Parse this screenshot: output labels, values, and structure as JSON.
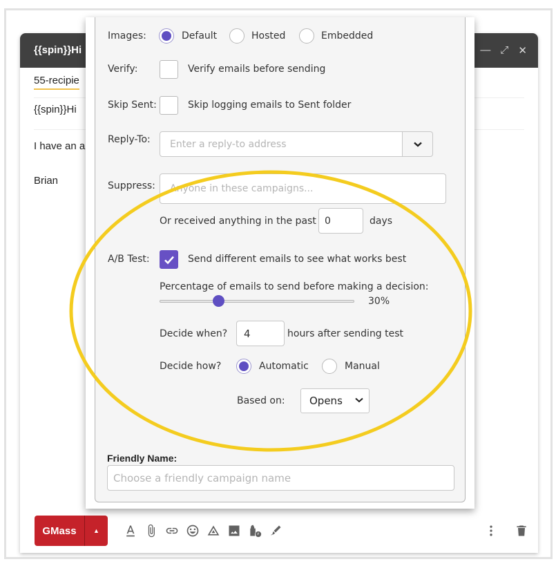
{
  "compose": {
    "title": "{{spin}}Hi",
    "to": "55-recipie",
    "subject": "{{spin}}Hi",
    "body_line1": "I have an a",
    "body_line2": "Brian",
    "window_controls": [
      "minimize-icon",
      "expand-icon",
      "close-icon"
    ]
  },
  "popup": {
    "images": {
      "label": "Images:",
      "options": [
        {
          "label": "Default",
          "selected": true
        },
        {
          "label": "Hosted",
          "selected": false
        },
        {
          "label": "Embedded",
          "selected": false
        }
      ]
    },
    "verify": {
      "label": "Verify:",
      "checked": false,
      "text": "Verify emails before sending"
    },
    "skip_sent": {
      "label": "Skip Sent:",
      "checked": false,
      "text": "Skip logging emails to Sent folder"
    },
    "reply_to": {
      "label": "Reply-To:",
      "value": "",
      "placeholder": "Enter a reply-to address"
    },
    "suppress": {
      "label": "Suppress:",
      "value": "",
      "placeholder": "Anyone in these campaigns...",
      "received_prefix": "Or received anything in the past",
      "days_value": "0",
      "days_suffix": "days"
    },
    "ab_test": {
      "label": "A/B Test:",
      "checked": true,
      "text": "Send different emails to see what works best",
      "percentage_label": "Percentage of emails to send before making a decision:",
      "percentage_value": 30,
      "percentage_text": "30%",
      "decide_when_label": "Decide when?",
      "decide_when_value": "4",
      "decide_when_suffix": "hours after sending test",
      "decide_how_label": "Decide how?",
      "decide_how_options": [
        {
          "label": "Automatic",
          "selected": true
        },
        {
          "label": "Manual",
          "selected": false
        }
      ],
      "based_on_label": "Based on:",
      "based_on_value": "Opens"
    },
    "friendly_name": {
      "label": "Friendly Name:",
      "value": "",
      "placeholder": "Choose a friendly campaign name"
    }
  },
  "toolbar": {
    "gmass_label": "GMass",
    "icons": [
      "text-format-icon",
      "attachment-icon",
      "link-icon",
      "emoji-icon",
      "drive-icon",
      "photo-icon",
      "confidential-mode-icon",
      "signature-icon"
    ],
    "more_icon": "more-options-icon",
    "delete_icon": "trash-icon"
  },
  "colors": {
    "accent": "#5f4fc2",
    "gmass_red": "#c5222a",
    "highlight_ellipse": "#f4cc1f",
    "header_dark": "#404040"
  }
}
